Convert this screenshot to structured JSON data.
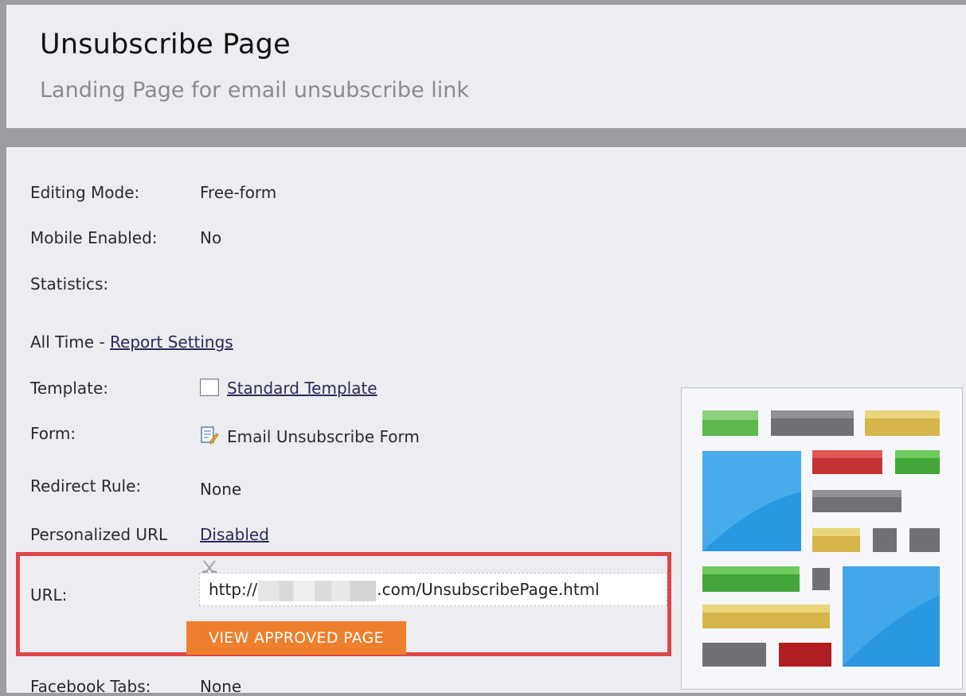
{
  "header": {
    "title": "Unsubscribe Page",
    "subtitle": "Landing Page for email unsubscribe link"
  },
  "details": {
    "editing_mode": {
      "label": "Editing Mode:",
      "value": "Free-form"
    },
    "mobile_enabled": {
      "label": "Mobile Enabled:",
      "value": "No"
    },
    "statistics": {
      "label": "Statistics:"
    },
    "all_time": {
      "text": "All Time - ",
      "link": "Report Settings"
    },
    "template": {
      "label": "Template:",
      "value": "Standard Template",
      "icon": "template-icon"
    },
    "form": {
      "label": "Form:",
      "value": "Email Unsubscribe Form",
      "icon": "form-edit-icon"
    },
    "redirect_rule": {
      "label": "Redirect Rule:",
      "value": "None"
    },
    "personalized_url": {
      "label": "Personalized URL",
      "value": "Disabled"
    },
    "url": {
      "label": "URL:",
      "prefix": "http://",
      "suffix": ".com/UnsubscribePage.html",
      "icon": "scissors-icon"
    },
    "view_button": "VIEW APPROVED PAGE",
    "facebook_tabs": {
      "label": "Facebook Tabs:",
      "value": "None"
    }
  },
  "colors": {
    "highlight_border": "#e04545",
    "button_bg": "#ee7f2d",
    "page_bg": "#ededf1"
  }
}
